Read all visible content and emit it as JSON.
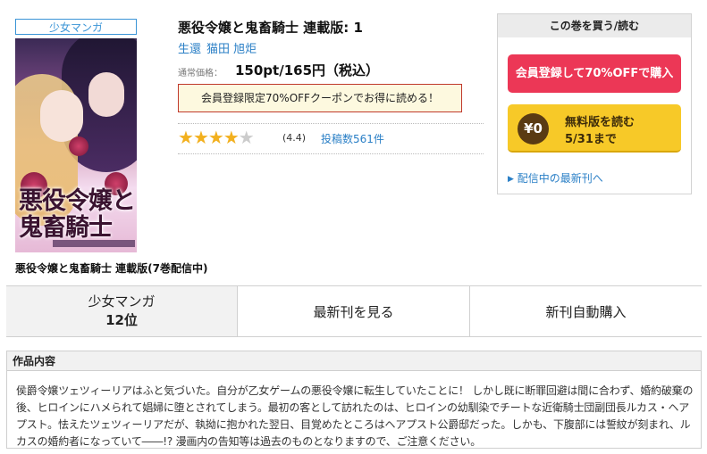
{
  "product": {
    "genre": "少女マンガ",
    "title": "悪役令嬢と鬼畜騎士 連載版: 1",
    "authors": [
      "生還",
      "猫田 旭炬"
    ],
    "price_label": "通常価格：",
    "price": "150pt/165円（税込）",
    "coupon": "会員登録限定70%OFFクーポンでお得に読める！",
    "cover_title_art": "悪役令嬢と鬼畜騎士",
    "series_caption": "悪役令嬢と鬼畜騎士 連載版(7巻配信中)",
    "rating": {
      "value": 4.4,
      "stars_full": 4,
      "stars_total": 5,
      "value_text": "(4.4)",
      "reviews": "投稿数561件"
    }
  },
  "buybox": {
    "header": "この巻を買う/読む",
    "member_button": "会員登録して70%OFFで購入",
    "free_icon": "¥0",
    "free_line1": "無料版を読む",
    "free_line2": "5/31まで",
    "latest_link": "配信中の最新刊へ"
  },
  "tabs": {
    "genre_label": "少女マンガ",
    "rank": "12位",
    "latest": "最新刊を見る",
    "auto_buy": "新刊自動購入"
  },
  "description": {
    "heading": "作品内容",
    "text": "侯爵令嬢ツェツィーリアはふと気づいた。自分が乙女ゲームの悪役令嬢に転生していたことに！ しかし既に断罪回避は間に合わず、婚約破棄の後、ヒロインにハメられて娼婦に堕とされてしまう。最初の客として訪れたのは、ヒロインの幼馴染でチートな近衛騎士団副団長ルカス・ヘアプスト。怯えたツェツィーリアだが、執拗に抱かれた翌日、目覚めたところはヘアプスト公爵邸だった。しかも、下腹部には誓紋が刻まれ、ルカスの婚約者になっていて――!? 漫画内の告知等は過去のものとなりますので、ご注意ください。"
  },
  "colors": {
    "accent_blue": "#2a7fc6",
    "member_red": "#ec3756",
    "free_yellow": "#f7c928",
    "rank_red": "#d0021b",
    "star_gold": "#f2b01e"
  }
}
